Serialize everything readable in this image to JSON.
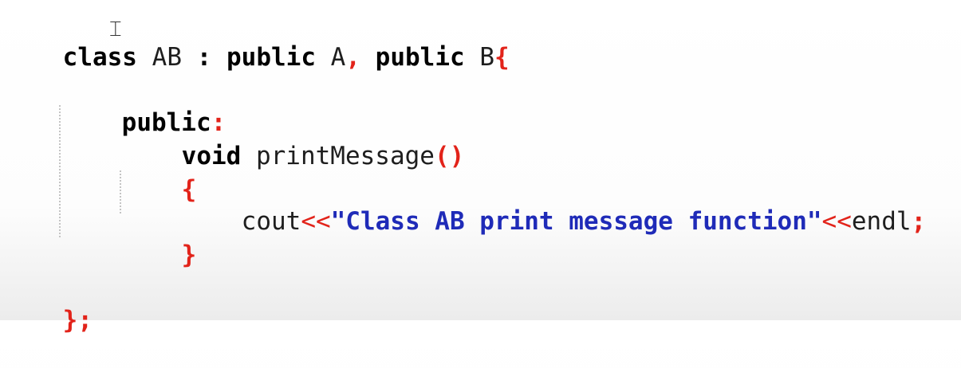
{
  "code": {
    "line1": {
      "kw_class": "class",
      "name": "AB",
      "colon": ":",
      "kw_public1": "public",
      "base1": "A",
      "comma": ",",
      "kw_public2": "public",
      "base2": "B",
      "brace_open": "{"
    },
    "line2": {
      "access": "public",
      "colon": ":"
    },
    "line3": {
      "kw_void": "void",
      "func": "printMessage",
      "parens": "()"
    },
    "line4": {
      "brace_open": "{"
    },
    "line5": {
      "cout": "cout",
      "op1": "<<",
      "string": "\"Class AB print message function\"",
      "op2": "<<",
      "endl": "endl",
      "semicolon": ";"
    },
    "line6": {
      "brace_close": "}"
    },
    "line7": {
      "brace_close": "}",
      "semicolon": ";"
    }
  },
  "colors": {
    "keyword": "#000000",
    "punctuation": "#e2231a",
    "string": "#1f2bb8",
    "identifier": "#1e1e1e"
  }
}
